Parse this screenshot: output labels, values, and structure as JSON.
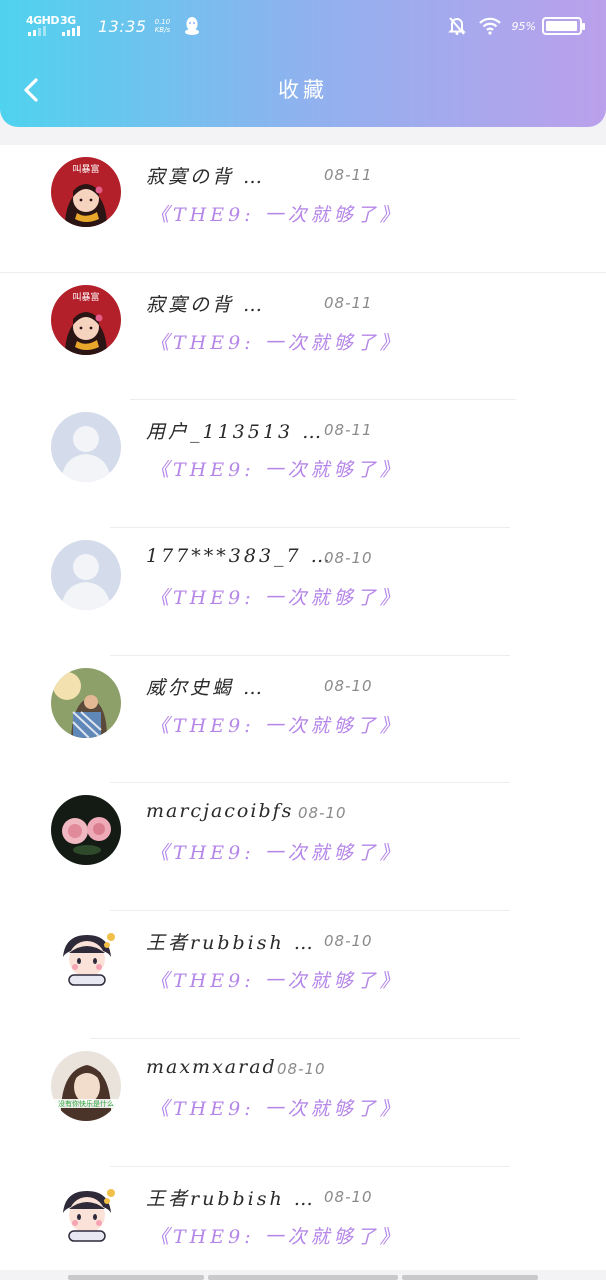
{
  "status_bar": {
    "network_1": "4GHD",
    "network_2": "3G",
    "time": "13:35",
    "speed_value": "0.10",
    "speed_unit": "KB/s",
    "battery": "95%"
  },
  "header": {
    "title": "收藏"
  },
  "favorites": [
    {
      "name": "寂寞の背 …",
      "date": "08-11",
      "song": "《THE9: 一次就够了》",
      "avatar": "cartoon-girl-red",
      "avatar_text": "叫暴富"
    },
    {
      "name": "寂寞の背 …",
      "date": "08-11",
      "song": "《THE9: 一次就够了》",
      "avatar": "cartoon-girl-red",
      "avatar_text": "叫暴富"
    },
    {
      "name": "用户_113513 …",
      "date": "08-11",
      "song": "《THE9: 一次就够了》",
      "avatar": "default-user"
    },
    {
      "name": "177***383_7 …",
      "date": "08-10",
      "song": "《THE9: 一次就够了》",
      "avatar": "default-user"
    },
    {
      "name": "威尔史蝎 …",
      "date": "08-10",
      "song": "《THE9: 一次就够了》",
      "avatar": "photo-couple"
    },
    {
      "name": "marcjacoibfs",
      "date": "08-10",
      "song": "《THE9: 一次就够了》",
      "avatar": "photo-roses"
    },
    {
      "name": "王者rubbish …",
      "date": "08-10",
      "song": "《THE9: 一次就够了》",
      "avatar": "cartoon-hug"
    },
    {
      "name": "maxmxarad",
      "date": "08-10",
      "song": "《THE9: 一次就够了》",
      "avatar": "photo-girl",
      "avatar_text": "没有你快乐是什么"
    },
    {
      "name": "王者rubbish …",
      "date": "08-10",
      "song": "《THE9: 一次就够了》",
      "avatar": "cartoon-hug"
    }
  ],
  "colors": {
    "header_gradient_start": "#4fd3ee",
    "header_gradient_end": "#bba0ec",
    "song_text": "#b586e8",
    "date_text": "#8a8a8a"
  }
}
